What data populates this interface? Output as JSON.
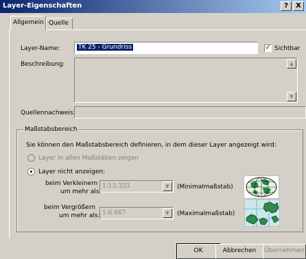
{
  "window": {
    "title": "Layer-Eigenschaften",
    "help_glyph": "?",
    "close_glyph": "X"
  },
  "tabs": [
    {
      "label": "Allgemein",
      "active": true
    },
    {
      "label": "Quelle",
      "active": false
    }
  ],
  "general": {
    "layer_name_label": "Layer-Name:",
    "layer_name_value": "TK 25 - Grundriss",
    "visible_label": "Sichtbar",
    "visible_checked": true,
    "description_label": "Beschreibung:",
    "description_value": "",
    "source_label": "Quellennachweis:",
    "source_value": ""
  },
  "scale_range": {
    "legend": "Maßstabsbereich",
    "intro": "Sie können den Maßstabsbereich definieren, in dem dieser Layer angezeigt wird:",
    "option_all": "Layer in allen Maßstäben zeigen",
    "option_hide": "Layer nicht anzeigen:",
    "selected_option": "option_hide",
    "zoom_out_label_1": "beim Verkleinern",
    "zoom_out_label_2": "um mehr als:",
    "zoom_out_value": "1:13.333",
    "min_scale_label": "(Minimalmaßstab)",
    "zoom_in_label_1": "beim Vergrößern",
    "zoom_in_label_2": "um mehr als:",
    "zoom_in_value": "1:6.667",
    "max_scale_label": "(Maximalmaßstab)"
  },
  "buttons": {
    "ok": "OK",
    "cancel": "Abbrechen",
    "apply": "Übernehmen"
  },
  "colors": {
    "titlebar_start": "#0a246a",
    "titlebar_end": "#a6caf0",
    "face": "#d4d0c8",
    "selection": "#0a246a",
    "globe_sea": "#e6f2e0",
    "globe_land": "#1f8a4c",
    "map_sea": "#cce8ee",
    "map_land": "#2e8b4d"
  }
}
